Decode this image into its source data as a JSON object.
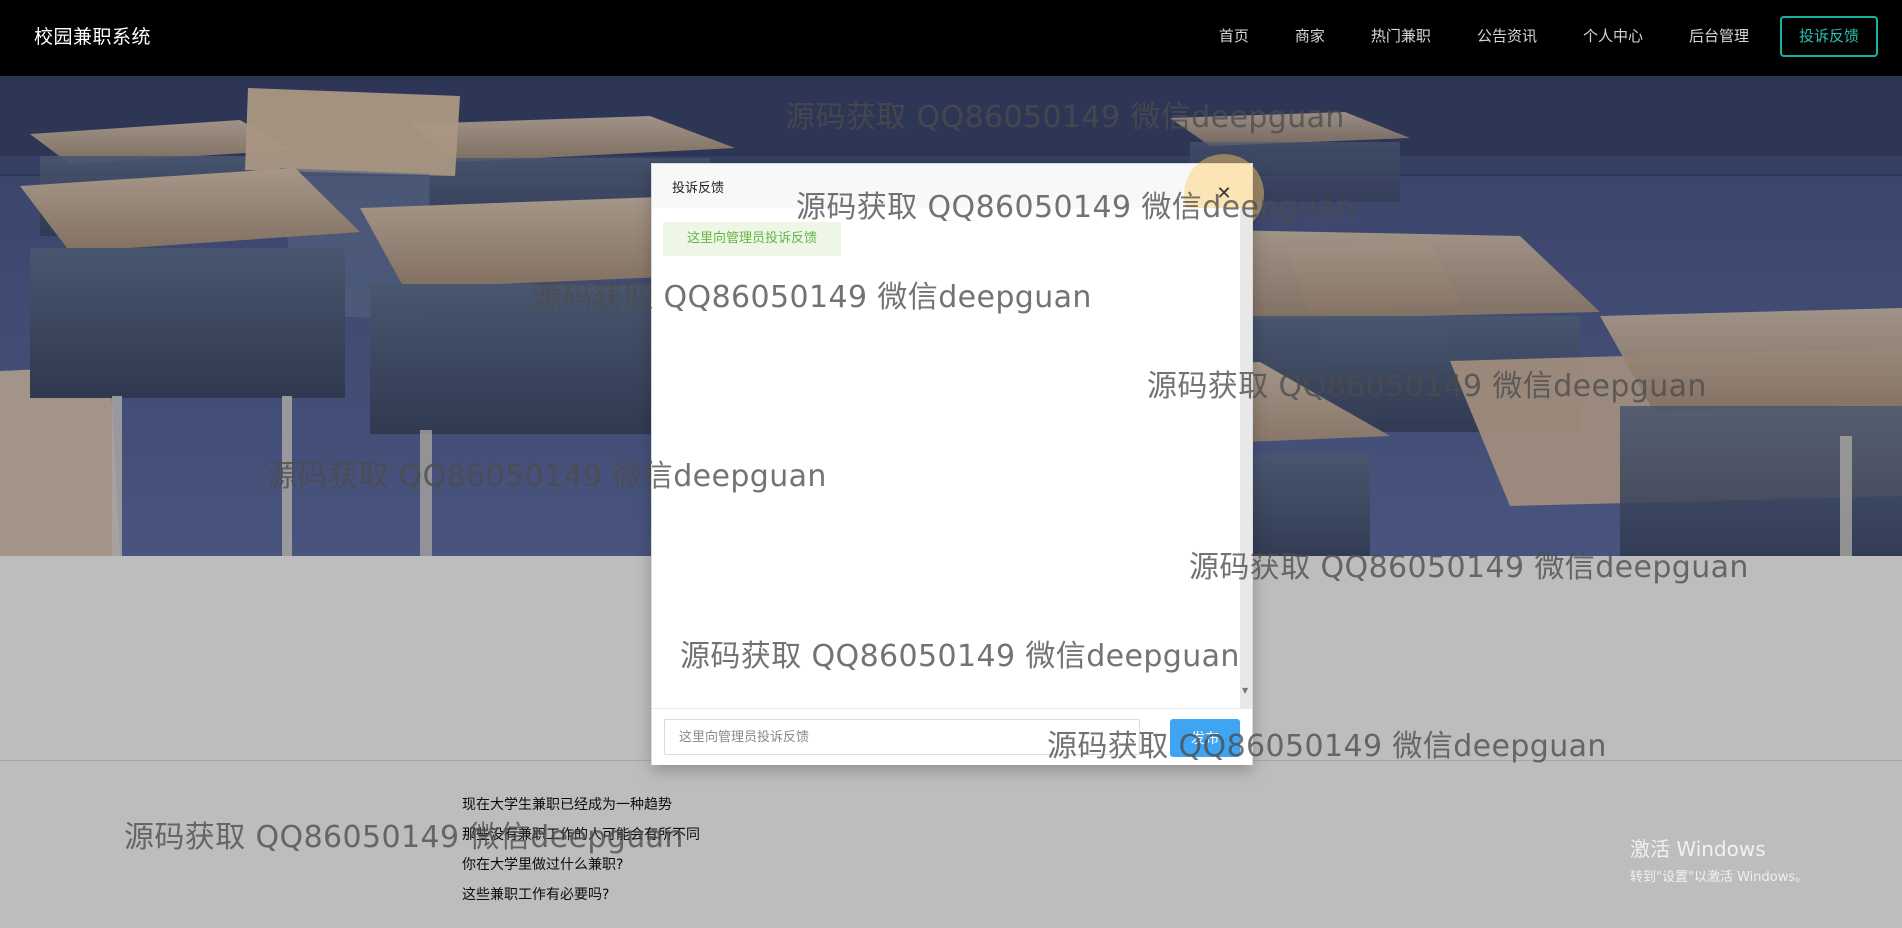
{
  "site": {
    "brand": "校园兼职系统"
  },
  "nav": {
    "items": [
      {
        "label": "首页"
      },
      {
        "label": "商家"
      },
      {
        "label": "热门兼职"
      },
      {
        "label": "公告资讯"
      },
      {
        "label": "个人中心"
      },
      {
        "label": "后台管理"
      }
    ],
    "cta_label": "投诉反馈"
  },
  "modal": {
    "title": "投诉反馈",
    "tip": "这里向管理员投诉反馈",
    "input_placeholder": "这里向管理员投诉反馈",
    "send_label": "发布"
  },
  "articles": [
    "现在大学生兼职已经成为一种趋势",
    "那些没有兼职工作的人可能会有所不同",
    "你在大学里做过什么兼职?",
    "这些兼职工作有必要吗?"
  ],
  "watermark": {
    "text": "源码获取 QQ86050149 微信deepguan"
  },
  "windows_activation": {
    "title": "激活 Windows",
    "subtitle": "转到\"设置\"以激活 Windows。"
  }
}
